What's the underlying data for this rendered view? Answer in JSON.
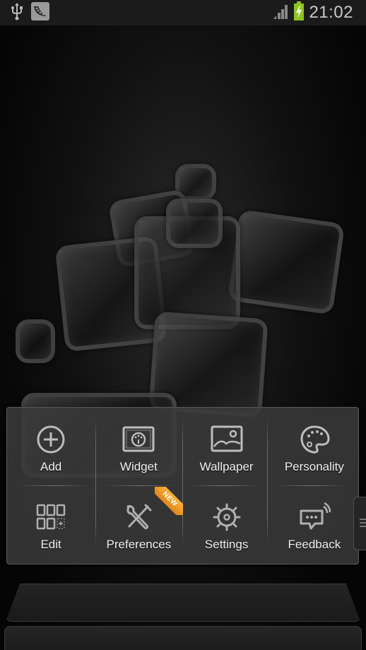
{
  "status_bar": {
    "left_icons": [
      "usb-icon",
      "peapod-notification-icon"
    ],
    "signal_icon": "signal-icon",
    "battery_icon": "battery-charging-icon",
    "battery_color": "#8fc31f",
    "time": "21:02"
  },
  "menu": {
    "items": [
      {
        "label": "Add",
        "icon": "add-circle-icon"
      },
      {
        "label": "Widget",
        "icon": "widget-icon"
      },
      {
        "label": "Wallpaper",
        "icon": "wallpaper-icon"
      },
      {
        "label": "Personality",
        "icon": "palette-icon"
      },
      {
        "label": "Edit",
        "icon": "edit-grid-icon"
      },
      {
        "label": "Preferences",
        "icon": "tools-icon",
        "badge": "NEW"
      },
      {
        "label": "Settings",
        "icon": "gear-icon"
      },
      {
        "label": "Feedback",
        "icon": "feedback-icon"
      }
    ],
    "badge_color": "#f0a030"
  }
}
